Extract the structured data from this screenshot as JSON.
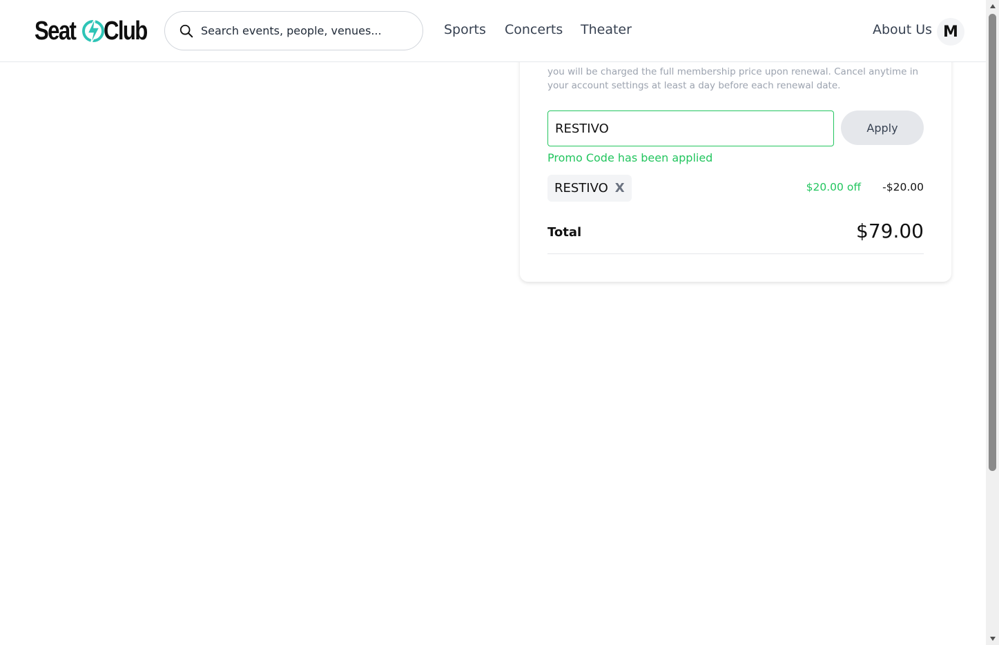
{
  "brand": {
    "logo_left": "Seat",
    "logo_right": "Club",
    "accent_color": "#2ec4b6"
  },
  "search": {
    "placeholder": "Search events, people, venues..."
  },
  "nav": {
    "sports": "Sports",
    "concerts": "Concerts",
    "theater": "Theater",
    "about": "About Us"
  },
  "user": {
    "avatar_initial": "M"
  },
  "checkout": {
    "terms_text": "you will be charged the full membership price upon renewal. Cancel anytime in your account settings at least a day before each renewal date.",
    "promo_code_value": "RESTIVO",
    "apply_label": "Apply",
    "promo_status": "Promo Code has been applied",
    "applied_code": "RESTIVO",
    "remove_glyph": "X",
    "discount_label": "$20.00 off",
    "discount_amount": "-$20.00",
    "total_label": "Total",
    "total_value": "$79.00"
  },
  "colors": {
    "success": "#22c55e",
    "muted_text": "#9ca3af",
    "apply_bg": "#e5e7eb"
  }
}
